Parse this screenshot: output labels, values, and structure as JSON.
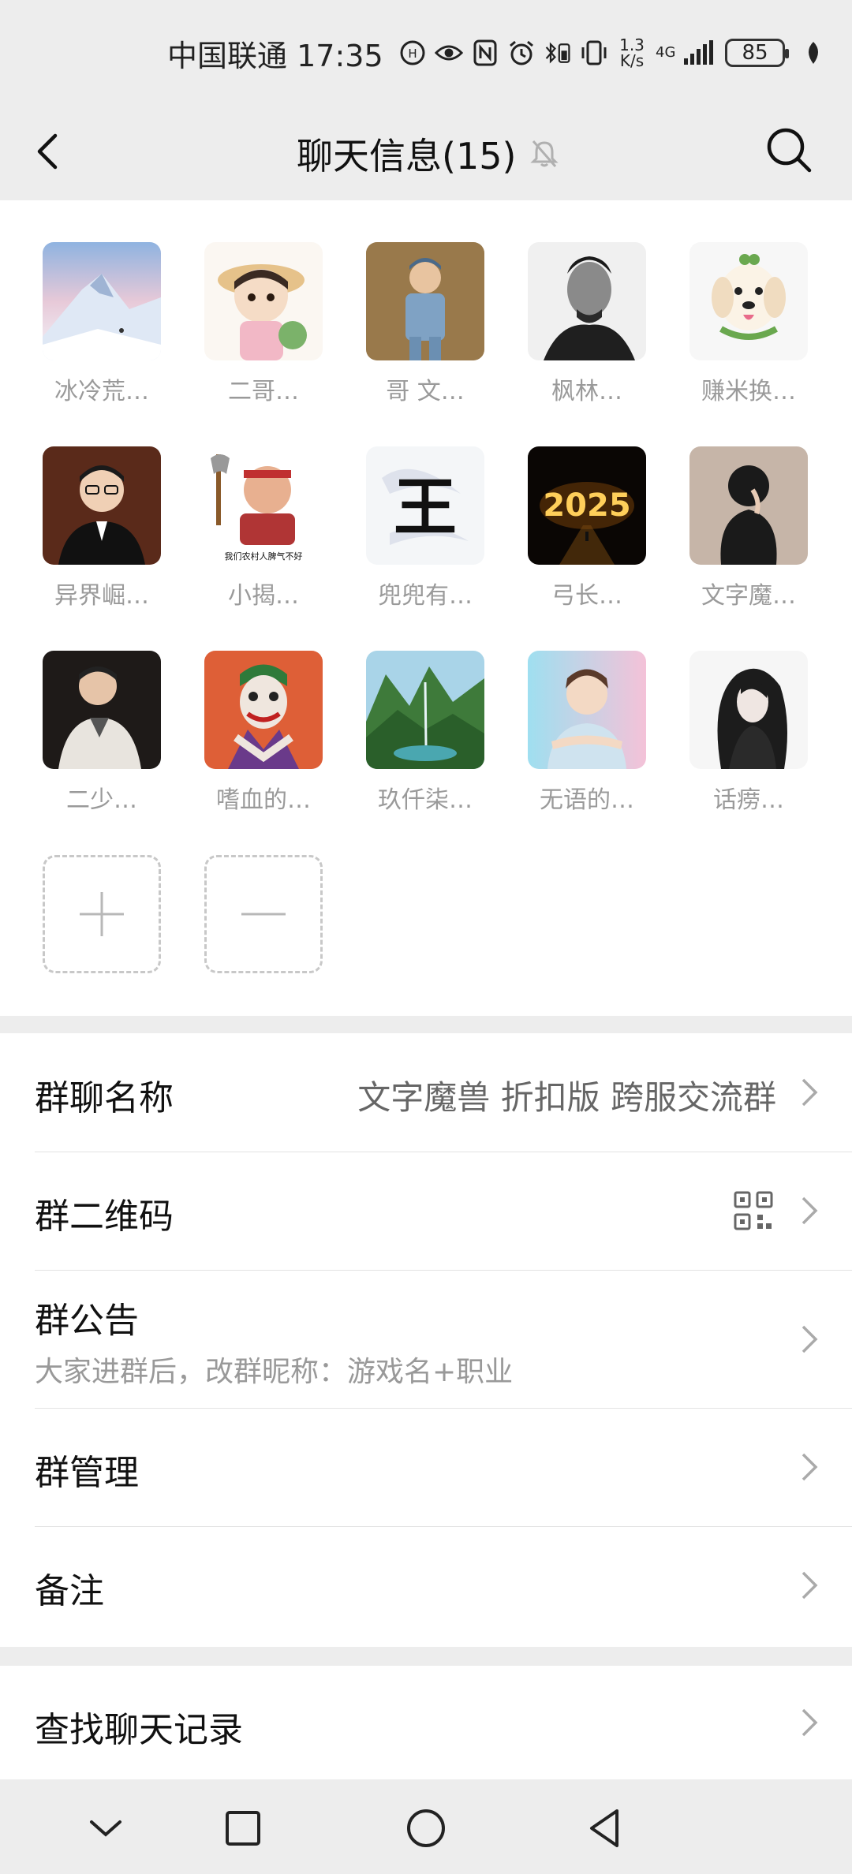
{
  "status_bar": {
    "carrier": "中国联通",
    "time": "17:35",
    "net_speed_top": "1.3",
    "net_speed_bottom": "K/s",
    "network": "4G",
    "battery": "85"
  },
  "header": {
    "title": "聊天信息(15)",
    "back_icon": "back-arrow-icon",
    "mute_icon": "bell-muted-icon",
    "search_icon": "search-icon"
  },
  "members": [
    {
      "name": "冰冷荒…",
      "avatar": "snow-mountain"
    },
    {
      "name": "二哥…",
      "avatar": "cartoon-boy-hat"
    },
    {
      "name": "哥 文…",
      "avatar": "child-uniform"
    },
    {
      "name": "枫林…",
      "avatar": "man-portrait-bw"
    },
    {
      "name": "赚米换…",
      "avatar": "white-dog"
    },
    {
      "name": "异界崛…",
      "avatar": "man-glasses-suit"
    },
    {
      "name": "小揭…",
      "avatar": "meme-man-axe"
    },
    {
      "name": "兜兜有…",
      "avatar": "calligraphy-wang"
    },
    {
      "name": "弓长…",
      "avatar": "neon-2025"
    },
    {
      "name": "文字魔…",
      "avatar": "dark-hair-figure"
    },
    {
      "name": "二少…",
      "avatar": "man-white-jacket"
    },
    {
      "name": "嗜血的…",
      "avatar": "joker"
    },
    {
      "name": "玖仟柒…",
      "avatar": "green-valley"
    },
    {
      "name": "无语的…",
      "avatar": "anime-boy"
    },
    {
      "name": "话痨…",
      "avatar": "sketch-woman"
    }
  ],
  "meme_caption": "我们农村人脾气不好",
  "neon_text": "2025",
  "calligraphy_char": "王",
  "member_actions": {
    "add_icon": "plus-icon",
    "remove_icon": "minus-icon"
  },
  "settings": {
    "group_name_label": "群聊名称",
    "group_name_value": "文字魔兽 折扣版 跨服交流群",
    "qr_label": "群二维码",
    "qr_icon": "qr-code-icon",
    "notice_label": "群公告",
    "notice_value": "大家进群后，改群昵称：游戏名+职业",
    "manage_label": "群管理",
    "remark_label": "备注",
    "search_history_label": "查找聊天记录"
  },
  "nav_bar": {
    "icons": [
      "chevron-down-icon",
      "square-icon",
      "circle-icon",
      "triangle-back-icon"
    ]
  }
}
